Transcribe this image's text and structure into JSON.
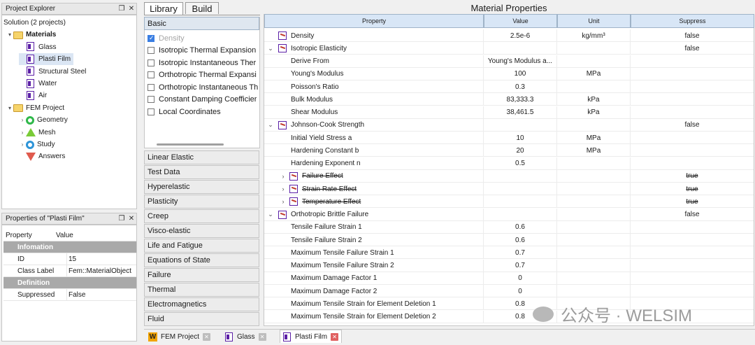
{
  "project_explorer": {
    "title": "Project Explorer",
    "tree": [
      {
        "label": "Solution (2 projects)",
        "level": 0,
        "expander": "",
        "icon": "none"
      },
      {
        "label": "Materials",
        "level": 1,
        "expander": "expanded",
        "icon": "folder",
        "bold": true
      },
      {
        "label": "Glass",
        "level": 2,
        "expander": "",
        "icon": "material"
      },
      {
        "label": "Plasti Film",
        "level": 2,
        "expander": "",
        "icon": "material",
        "selected": true
      },
      {
        "label": "Structural Steel",
        "level": 2,
        "expander": "",
        "icon": "material"
      },
      {
        "label": "Water",
        "level": 2,
        "expander": "",
        "icon": "material"
      },
      {
        "label": "Air",
        "level": 2,
        "expander": "",
        "icon": "material"
      },
      {
        "label": "FEM Project",
        "level": 1,
        "expander": "expanded",
        "icon": "folder"
      },
      {
        "label": "Geometry",
        "level": 2,
        "expander": "collapsed",
        "icon": "geometry"
      },
      {
        "label": "Mesh",
        "level": 2,
        "expander": "collapsed",
        "icon": "mesh"
      },
      {
        "label": "Study",
        "level": 2,
        "expander": "collapsed",
        "icon": "study"
      },
      {
        "label": "Answers",
        "level": 2,
        "expander": "",
        "icon": "answers"
      }
    ]
  },
  "properties_panel": {
    "title": "Properties of \"Plasti Film\"",
    "col_property": "Property",
    "col_value": "Value",
    "rows": [
      {
        "type": "group",
        "label": "Infomation"
      },
      {
        "type": "row",
        "property": "ID",
        "value": "15"
      },
      {
        "type": "row",
        "property": "Class Label",
        "value": "Fem::MaterialObject"
      },
      {
        "type": "group",
        "label": "Definition"
      },
      {
        "type": "row",
        "property": "Suppressed",
        "value": "False"
      }
    ]
  },
  "tabs": {
    "library": "Library",
    "build": "Build"
  },
  "basic": {
    "header": "Basic",
    "items": [
      {
        "label": "Density",
        "checked": true,
        "disabled": true
      },
      {
        "label": "Isotropic Thermal Expansion",
        "checked": false
      },
      {
        "label": "Isotropic Instantaneous Ther",
        "checked": false
      },
      {
        "label": "Orthotropic Thermal Expansi",
        "checked": false
      },
      {
        "label": "Orthotropic Instantaneous Th",
        "checked": false
      },
      {
        "label": "Constant Damping Coefficier",
        "checked": false
      },
      {
        "label": "Local Coordinates",
        "checked": false
      }
    ]
  },
  "categories": [
    "Linear Elastic",
    "Test Data",
    "Hyperelastic",
    "Plasticity",
    "Creep",
    "Visco-elastic",
    "Life and Fatigue",
    "Equations of State",
    "Failure",
    "Thermal",
    "Electromagnetics",
    "Fluid"
  ],
  "material_properties": {
    "title": "Material Properties",
    "columns": {
      "property": "Property",
      "value": "Value",
      "unit": "Unit",
      "suppress": "Suppress"
    },
    "rows": [
      {
        "level": 0,
        "expander": "",
        "icon": true,
        "property": "Density",
        "value": "2.5e-6",
        "unit": "kg/mm³",
        "suppress": "false"
      },
      {
        "level": 0,
        "expander": "expanded",
        "icon": true,
        "property": "Isotropic Elasticity",
        "value": "",
        "unit": "",
        "suppress": "false"
      },
      {
        "level": 1,
        "property": "Derive From",
        "value": "Young's Modulus a...",
        "unit": "",
        "suppress": ""
      },
      {
        "level": 1,
        "property": "Young's Modulus",
        "value": "100",
        "unit": "MPa",
        "suppress": ""
      },
      {
        "level": 1,
        "property": "Poisson's Ratio",
        "value": "0.3",
        "unit": "",
        "suppress": ""
      },
      {
        "level": 1,
        "property": "Bulk Modulus",
        "value": "83,333.3",
        "unit": "kPa",
        "suppress": ""
      },
      {
        "level": 1,
        "property": "Shear Modulus",
        "value": "38,461.5",
        "unit": "kPa",
        "suppress": ""
      },
      {
        "level": 0,
        "expander": "expanded",
        "icon": true,
        "property": "Johnson-Cook Strength",
        "value": "",
        "unit": "",
        "suppress": "false"
      },
      {
        "level": 1,
        "property": "Initial Yield Stress a",
        "value": "10",
        "unit": "MPa",
        "suppress": ""
      },
      {
        "level": 1,
        "property": "Hardening Constant b",
        "value": "20",
        "unit": "MPa",
        "suppress": ""
      },
      {
        "level": 1,
        "property": "Hardening Exponent n",
        "value": "0.5",
        "unit": "",
        "suppress": ""
      },
      {
        "level": 1,
        "expander": "collapsed",
        "icon": true,
        "struck": true,
        "property": "Failure Effect",
        "value": "",
        "unit": "",
        "suppress": "true"
      },
      {
        "level": 1,
        "expander": "collapsed",
        "icon": true,
        "struck": true,
        "property": "Strain Rate Effect",
        "value": "",
        "unit": "",
        "suppress": "true"
      },
      {
        "level": 1,
        "expander": "collapsed",
        "icon": true,
        "struck": true,
        "property": "Temperature Effect",
        "value": "",
        "unit": "",
        "suppress": "true"
      },
      {
        "level": 0,
        "expander": "expanded",
        "icon": true,
        "property": "Orthotropic Brittle Failure",
        "value": "",
        "unit": "",
        "suppress": "false"
      },
      {
        "level": 1,
        "property": "Tensile Failure Strain 1",
        "value": "0.6",
        "unit": "",
        "suppress": ""
      },
      {
        "level": 1,
        "property": "Tensile Failure Strain 2",
        "value": "0.6",
        "unit": "",
        "suppress": ""
      },
      {
        "level": 1,
        "property": "Maximum Tensile Failure Strain 1",
        "value": "0.7",
        "unit": "",
        "suppress": ""
      },
      {
        "level": 1,
        "property": "Maximum Tensile Failure Strain 2",
        "value": "0.7",
        "unit": "",
        "suppress": ""
      },
      {
        "level": 1,
        "property": "Maximum Damage Factor 1",
        "value": "0",
        "unit": "",
        "suppress": ""
      },
      {
        "level": 1,
        "property": "Maximum Damage Factor 2",
        "value": "0",
        "unit": "",
        "suppress": ""
      },
      {
        "level": 1,
        "property": "Maximum Tensile Strain for Element Deletion 1",
        "value": "0.8",
        "unit": "",
        "suppress": ""
      },
      {
        "level": 1,
        "property": "Maximum Tensile Strain for Element Deletion 2",
        "value": "0.8",
        "unit": "",
        "suppress": ""
      }
    ]
  },
  "bottom_tabs": [
    {
      "label": "FEM Project",
      "icon": "W"
    },
    {
      "label": "Glass",
      "icon": "material"
    },
    {
      "label": "Plasti Film",
      "icon": "material",
      "active": true
    }
  ],
  "watermark": "公众号 · WELSIM"
}
